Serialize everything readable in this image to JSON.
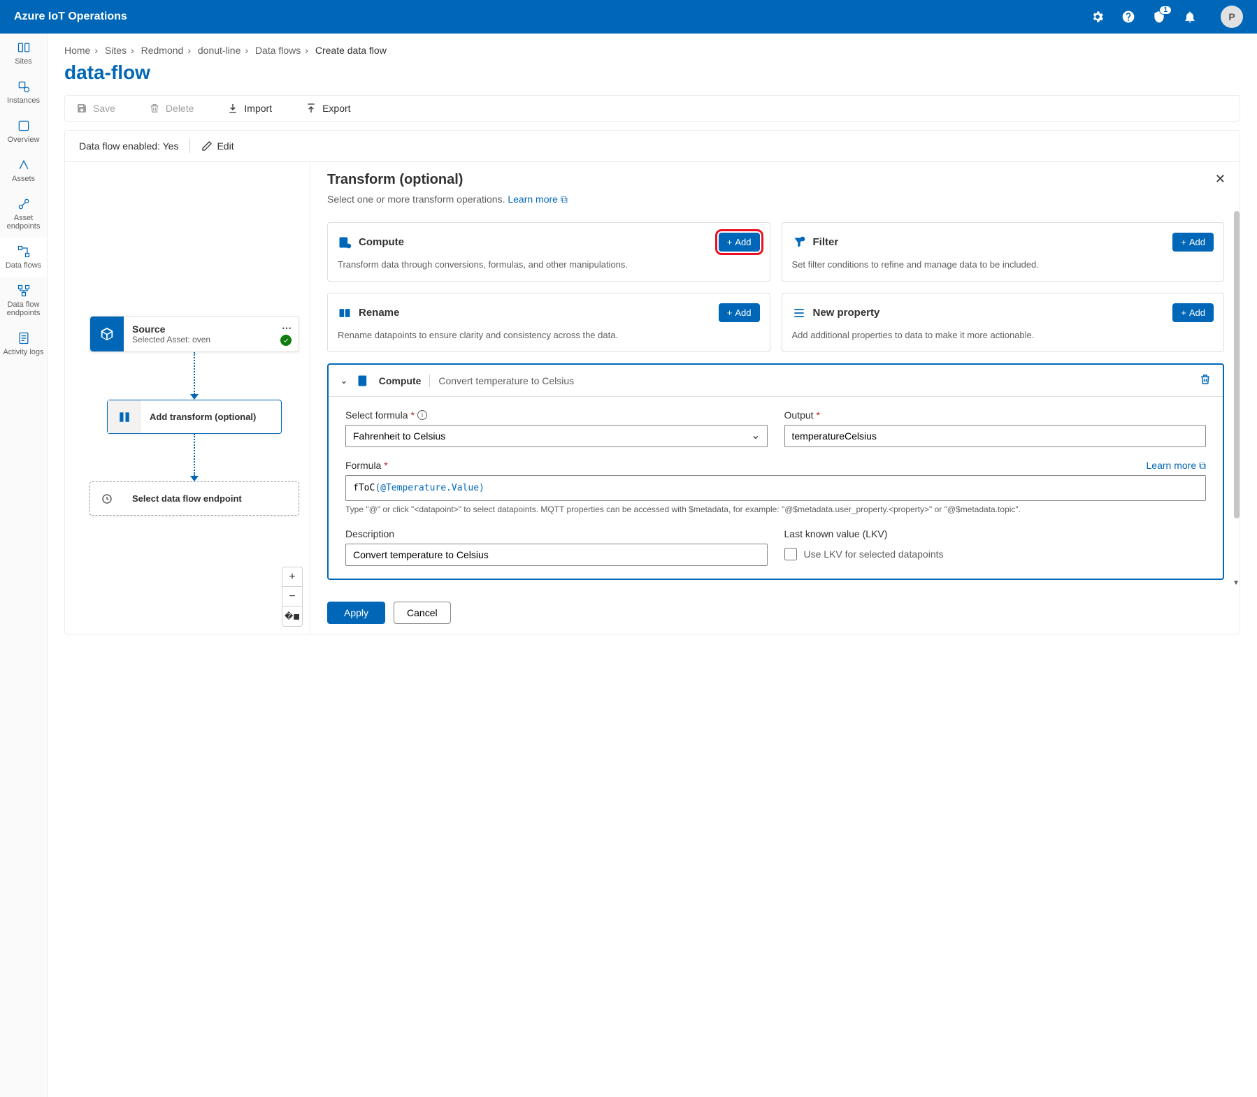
{
  "app_title": "Azure IoT Operations",
  "notification_count": "1",
  "avatar_initial": "P",
  "sidenav": [
    {
      "label": "Sites"
    },
    {
      "label": "Instances"
    },
    {
      "label": "Overview"
    },
    {
      "label": "Assets"
    },
    {
      "label": "Asset endpoints"
    },
    {
      "label": "Data flows"
    },
    {
      "label": "Data flow endpoints"
    },
    {
      "label": "Activity logs"
    }
  ],
  "breadcrumb": [
    "Home",
    "Sites",
    "Redmond",
    "donut-line",
    "Data flows"
  ],
  "breadcrumb_current": "Create data flow",
  "page_title": "data-flow",
  "toolbar": {
    "save": "Save",
    "delete": "Delete",
    "import": "Import",
    "export": "Export"
  },
  "status": {
    "label": "Data flow enabled: Yes",
    "edit": "Edit"
  },
  "nodes": {
    "source_title": "Source",
    "source_sub": "Selected Asset: oven",
    "transform_label": "Add transform (optional)",
    "endpoint_label": "Select data flow endpoint"
  },
  "panel": {
    "title": "Transform (optional)",
    "subtitle": "Select one or more transform operations. ",
    "learn_more": "Learn more"
  },
  "ops": {
    "compute": {
      "title": "Compute",
      "desc": "Transform data through conversions, formulas, and other manipulations.",
      "btn": "Add"
    },
    "filter": {
      "title": "Filter",
      "desc": "Set filter conditions to refine and manage data to be included.",
      "btn": "Add"
    },
    "rename": {
      "title": "Rename",
      "desc": "Rename datapoints to ensure clarity and consistency across the data.",
      "btn": "Add"
    },
    "newprop": {
      "title": "New property",
      "desc": "Add additional properties to data to make it more actionable.",
      "btn": "Add"
    }
  },
  "compute": {
    "head_title": "Compute",
    "head_sub": "Convert temperature to Celsius",
    "select_formula_label": "Select formula",
    "select_formula_value": "Fahrenheit to Celsius",
    "output_label": "Output",
    "output_value": "temperatureCelsius",
    "formula_label": "Formula",
    "formula_fn": "fToC",
    "formula_arg": "@Temperature.Value",
    "formula_hint": "Type \"@\" or click \"<datapoint>\" to select datapoints. MQTT properties can be accessed with $metadata, for example: \"@$metadata.user_property.<property>\" or \"@$metadata.topic\".",
    "description_label": "Description",
    "description_value": "Convert temperature to Celsius",
    "lkv_label": "Last known value (LKV)",
    "lkv_checkbox_label": "Use LKV for selected datapoints",
    "learn_more": "Learn more"
  },
  "footer": {
    "apply": "Apply",
    "cancel": "Cancel"
  }
}
